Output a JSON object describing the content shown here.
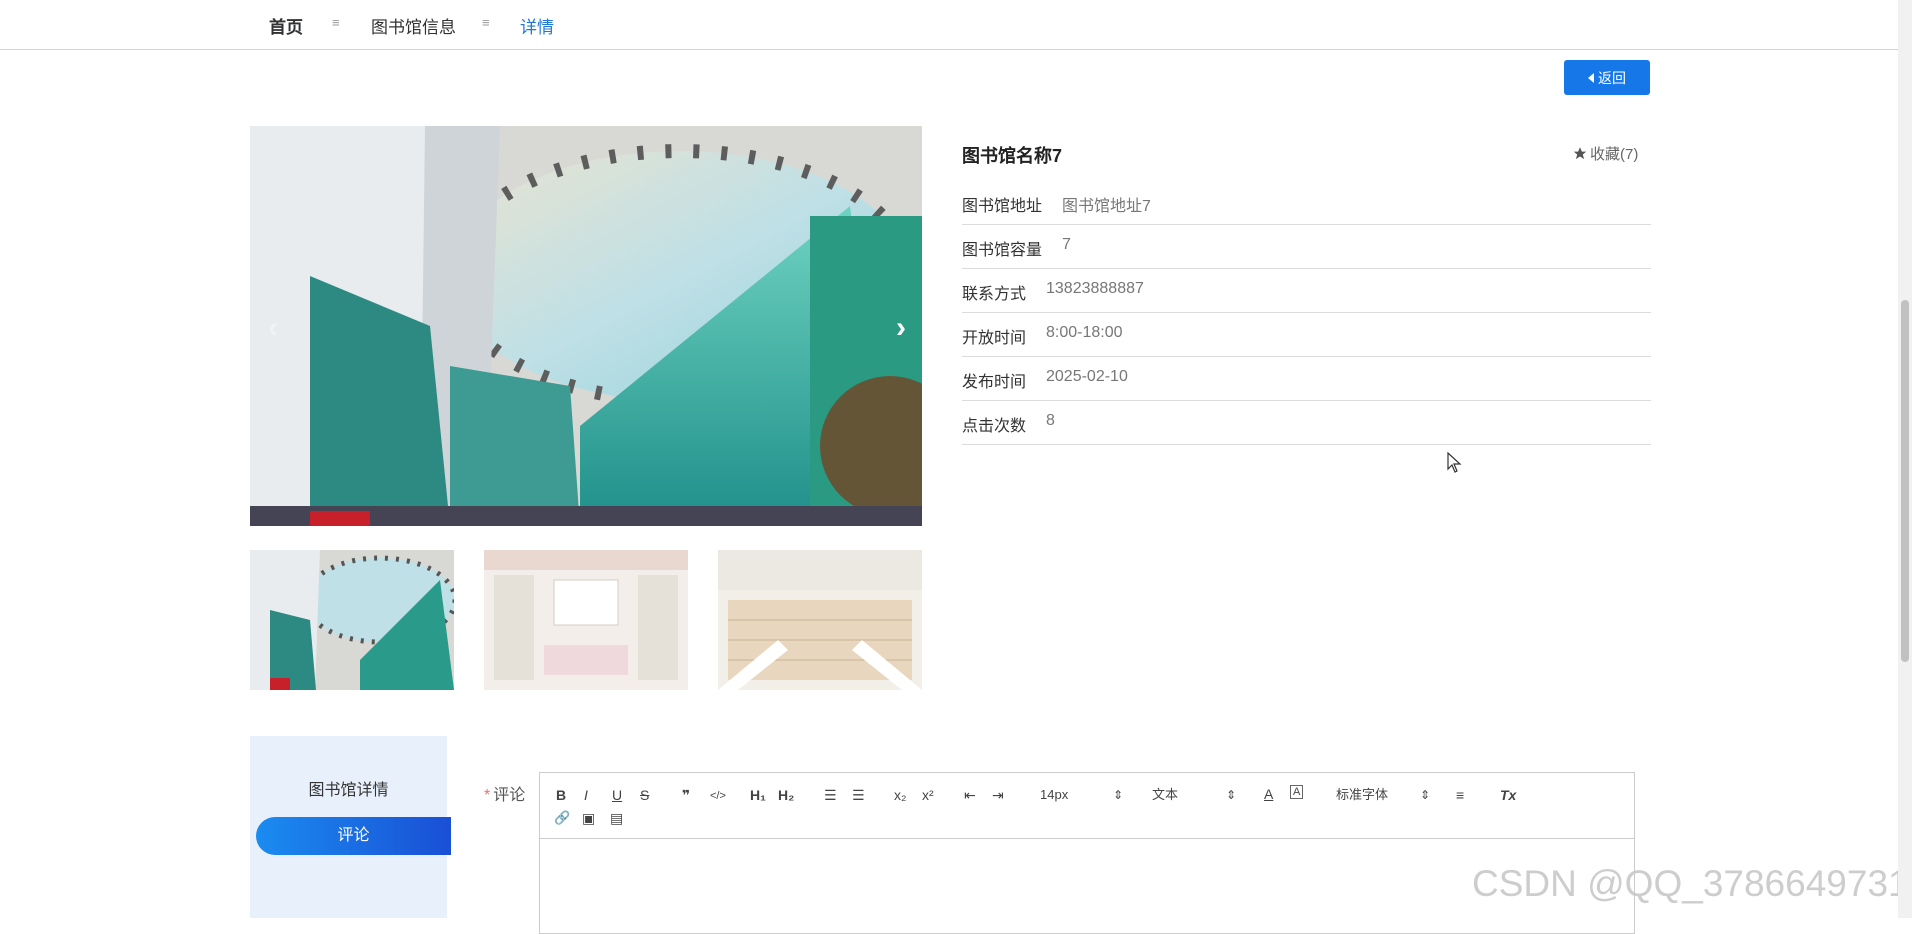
{
  "breadcrumb": {
    "home": "首页",
    "separator": "≡",
    "library_info": "图书馆信息",
    "current": "详情"
  },
  "back_button": {
    "label": "返回",
    "icon": "caret-left-icon"
  },
  "library": {
    "title": "图书馆名称7",
    "favorite": {
      "icon": "star-icon",
      "label": "收藏(7)"
    },
    "fields": [
      {
        "label": "图书馆地址",
        "value": "图书馆地址7"
      },
      {
        "label": "图书馆容量",
        "value": "7"
      },
      {
        "label": "联系方式",
        "value": "13823888887"
      },
      {
        "label": "开放时间",
        "value": "8:00-18:00"
      },
      {
        "label": "发布时间",
        "value": "2025-02-10"
      },
      {
        "label": "点击次数",
        "value": "8"
      }
    ]
  },
  "carousel": {
    "prev_icon": "chevron-left-icon",
    "next_icon": "chevron-right-icon",
    "next_glyph": "›",
    "prev_glyph": "‹"
  },
  "tabs": {
    "detail": "图书馆详情",
    "comment": "评论"
  },
  "comment_form": {
    "required_mark": "*",
    "label": "评论"
  },
  "editor_toolbar": {
    "bold": "B",
    "italic": "I",
    "underline": "U",
    "strike": "S",
    "quote": "❞",
    "code": "</>",
    "h1": "H₁",
    "h2": "H₂",
    "ordered_list": "☰",
    "bullet_list": "☰",
    "subscript": "x₂",
    "superscript": "x²",
    "outdent": "⇤",
    "indent": "⇥",
    "size_select": "14px",
    "type_select": "文本",
    "font_color": "A",
    "background_color": "A",
    "font_select": "标准字体",
    "align": "≡",
    "clean": "Tx",
    "link": "🔗",
    "image": "▣",
    "video": "▤",
    "select_arrows": "⇕"
  },
  "watermark": "CSDN @QQ_3786649731",
  "colors": {
    "primary": "#1677e8",
    "active_crumb": "#1e78d6",
    "side_bg": "#e8f1fb"
  }
}
